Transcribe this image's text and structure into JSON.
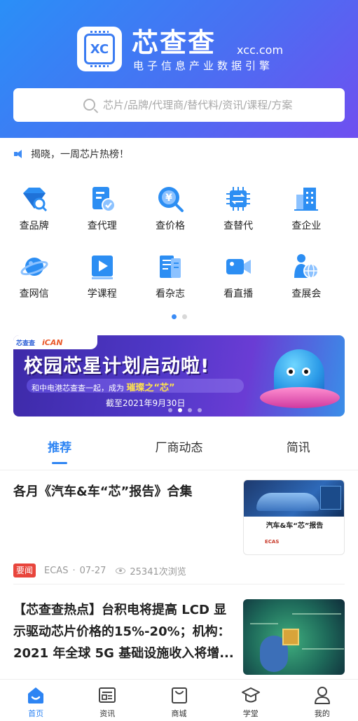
{
  "header": {
    "brand_name": "芯查查",
    "domain": "xcc.com",
    "tagline": "电子信息产业数据引擎",
    "logo_mark": "XC"
  },
  "search": {
    "placeholder": "芯片/品牌/代理商/替代料/资讯/课程/方案",
    "value": ""
  },
  "notice": {
    "text": "揭晓，一周芯片热榜！"
  },
  "grid": {
    "items": [
      {
        "label": "查品牌",
        "icon": "diamond-search-icon"
      },
      {
        "label": "查代理",
        "icon": "document-check-icon"
      },
      {
        "label": "查价格",
        "icon": "yen-search-icon"
      },
      {
        "label": "查替代",
        "icon": "chip-swap-icon"
      },
      {
        "label": "查企业",
        "icon": "building-icon"
      },
      {
        "label": "查网信",
        "icon": "planet-icon"
      },
      {
        "label": "学课程",
        "icon": "video-play-icon"
      },
      {
        "label": "看杂志",
        "icon": "magazine-icon"
      },
      {
        "label": "看直播",
        "icon": "camera-icon"
      },
      {
        "label": "查展会",
        "icon": "person-globe-icon"
      }
    ],
    "page_indicator": {
      "pages": 2,
      "current": 1
    }
  },
  "banner": {
    "brand_left": "芯查查",
    "brand_right": "iCAN",
    "title": "校园芯星计划启动啦!",
    "subtitle_prefix": "和中电港芯查查一起，成为",
    "subtitle_strong": "璀璨之“芯”",
    "date": "截至2021年9月30日",
    "carousel": {
      "slides": 4,
      "current": 2
    }
  },
  "tabs": [
    {
      "label": "推荐",
      "active": true
    },
    {
      "label": "厂商动态",
      "active": false
    },
    {
      "label": "简讯",
      "active": false
    }
  ],
  "articles": [
    {
      "title": "各月《汽车&车“芯”报告》合集",
      "tag": "要闻",
      "source": "ECAS",
      "date": "07-27",
      "views": "25341次浏览",
      "thumb_title": "汽车&车“芯”报告",
      "thumb_logo": "ECAS"
    },
    {
      "title": "【芯查查热点】台积电将提高 LCD 显示驱动芯片价格的15%-20%；机构：2021 年全球 5G 基础设施收入将增..."
    }
  ],
  "bottom_nav": [
    {
      "label": "首页",
      "icon": "home-icon",
      "active": true
    },
    {
      "label": "资讯",
      "icon": "news-icon",
      "active": false
    },
    {
      "label": "商城",
      "icon": "shopping-bag-icon",
      "active": false
    },
    {
      "label": "学堂",
      "icon": "graduation-cap-icon",
      "active": false
    },
    {
      "label": "我的",
      "icon": "user-icon",
      "active": false
    }
  ],
  "colors": {
    "accent": "#2d84f3",
    "badge": "#e8453c",
    "header_start": "#2a8ff7",
    "header_end": "#6f4ff0"
  }
}
